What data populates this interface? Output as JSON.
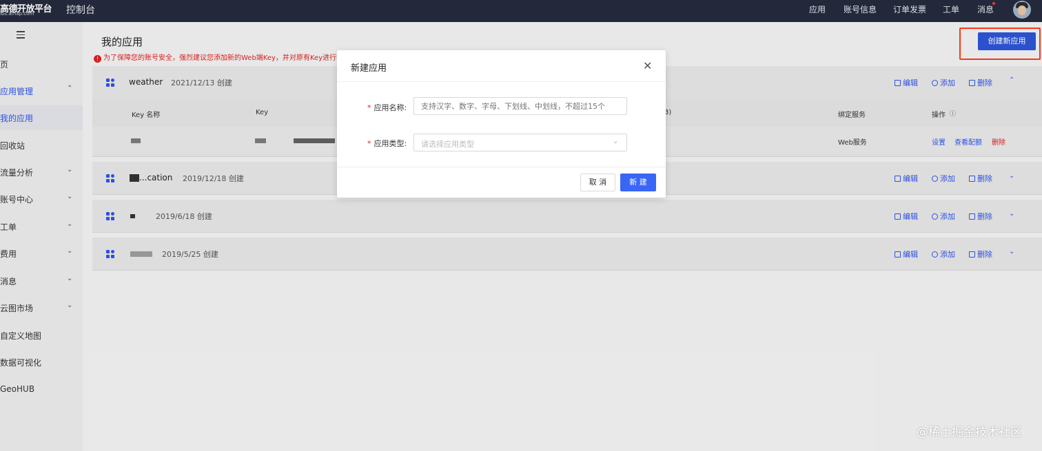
{
  "topbar": {
    "logo_line1": "高德开放平台",
    "logo_line2": "lbs.amap.com",
    "console": "控制台",
    "nav": [
      "应用",
      "账号信息",
      "订单发票",
      "工单",
      "消息"
    ]
  },
  "sidebar": {
    "items": [
      {
        "label": "页",
        "chevron": ""
      },
      {
        "label": "应用管理",
        "chevron": "⌃"
      },
      {
        "label": "我的应用",
        "chevron": ""
      },
      {
        "label": "回收站",
        "chevron": ""
      },
      {
        "label": "流量分析",
        "chevron": "⌄"
      },
      {
        "label": "账号中心",
        "chevron": "⌄"
      },
      {
        "label": "工单",
        "chevron": "⌄"
      },
      {
        "label": "费用",
        "chevron": "⌄"
      },
      {
        "label": "消息",
        "chevron": "⌄"
      },
      {
        "label": "云图市场",
        "chevron": "⌄"
      },
      {
        "label": "自定义地图",
        "chevron": ""
      },
      {
        "label": "数据可视化",
        "chevron": ""
      },
      {
        "label": "GeoHUB",
        "chevron": ""
      }
    ]
  },
  "main": {
    "title": "我的应用",
    "warning": "为了保障您的账号安全，强烈建议您添加新的Web端Key，并对原有Key进行替换",
    "create_button": "创建新应用",
    "actions": {
      "edit": "编辑",
      "add": "添加",
      "delete": "删除"
    },
    "apps": [
      {
        "name": "weather",
        "date": "2021/12/13 创建",
        "expanded": true
      },
      {
        "name": "...cation",
        "date": "2019/12/18 创建",
        "expanded": false
      },
      {
        "name": "",
        "date": "2019/6/18 创建",
        "expanded": false
      },
      {
        "name": "",
        "date": "2019/5/25 创建",
        "expanded": false
      }
    ],
    "table": {
      "headers": [
        "Key 名称",
        "Key",
        "绑定服务",
        "操作"
      ],
      "partial_header": "3)",
      "row": {
        "service": "Web服务",
        "setup": "设置",
        "view_config": "查看配额",
        "delete": "删除"
      }
    }
  },
  "modal": {
    "title": "新建应用",
    "name_label": "应用名称:",
    "name_placeholder": "支持汉字、数字、字母、下划线、中划线，不超过15个",
    "type_label": "应用类型:",
    "type_placeholder": "请选择应用类型",
    "cancel": "取 消",
    "confirm": "新 建",
    "required_mark": "*"
  },
  "watermark": "@稀土掘金技术社区"
}
